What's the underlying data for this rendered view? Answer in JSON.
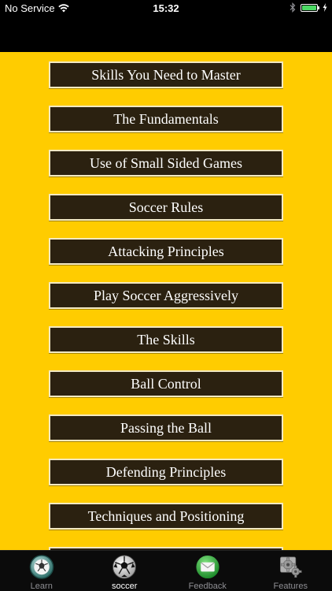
{
  "status_bar": {
    "carrier": "No Service",
    "time": "15:32"
  },
  "menu": {
    "items": [
      {
        "label": "Skills You Need to Master"
      },
      {
        "label": "The Fundamentals"
      },
      {
        "label": "Use of Small Sided Games"
      },
      {
        "label": "Soccer Rules"
      },
      {
        "label": "Attacking Principles"
      },
      {
        "label": "Play Soccer Aggressively"
      },
      {
        "label": "The Skills"
      },
      {
        "label": "Ball Control"
      },
      {
        "label": "Passing the Ball"
      },
      {
        "label": "Defending Principles"
      },
      {
        "label": "Techniques and Positioning"
      },
      {
        "label": ""
      }
    ]
  },
  "tab_bar": {
    "tabs": [
      {
        "label": "Learn",
        "icon": "learn-ball-icon"
      },
      {
        "label": "soccer",
        "icon": "soccer-ball-icon"
      },
      {
        "label": "Feedback",
        "icon": "envelope-icon"
      },
      {
        "label": "Features",
        "icon": "gears-icon"
      }
    ],
    "active_tab": "soccer"
  },
  "colors": {
    "content_background": "#ffcc00",
    "button_background": "#2b2110",
    "button_border": "#f3e9c2",
    "battery_fill": "#4cd964"
  }
}
